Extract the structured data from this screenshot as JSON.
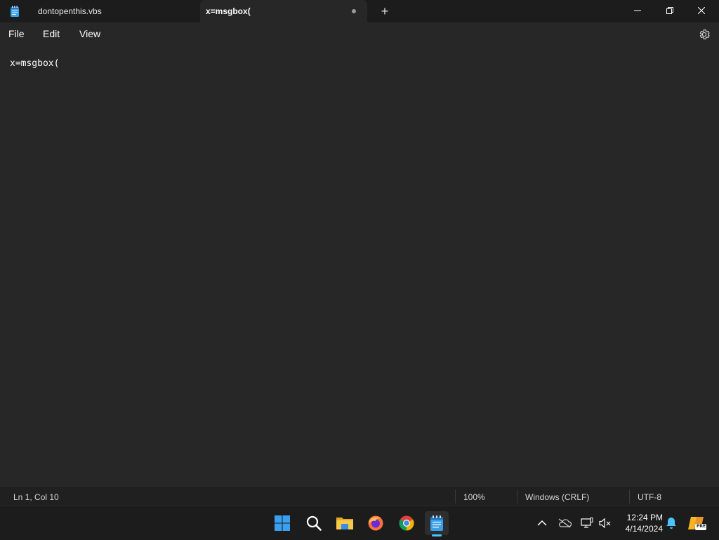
{
  "titlebar": {
    "tabs": [
      {
        "label": "dontopenthis.vbs",
        "active": false
      },
      {
        "label": "x=msgbox(",
        "active": true,
        "unsaved": true
      }
    ],
    "new_tab_label": "+"
  },
  "menu": {
    "file": "File",
    "edit": "Edit",
    "view": "View"
  },
  "editor": {
    "content": "x=msgbox("
  },
  "status": {
    "position": "Ln 1, Col 10",
    "zoom": "100%",
    "line_ending": "Windows (CRLF)",
    "encoding": "UTF-8"
  },
  "taskbar": {
    "apps": [
      "start-icon",
      "search-icon",
      "file-explorer-icon",
      "firefox-icon",
      "chrome-icon",
      "notepad-icon"
    ],
    "tray": [
      "chevron-up-icon",
      "onedrive-off-icon",
      "network-icon",
      "volume-muted-icon",
      "notification-bell-icon",
      "copilot-icon"
    ],
    "time": "12:24 PM",
    "date": "4/14/2024",
    "copilot_badge": "PRE"
  },
  "colors": {
    "accent": "#4cc2ff",
    "background": "#272727",
    "titlebar": "#1c1c1c"
  }
}
